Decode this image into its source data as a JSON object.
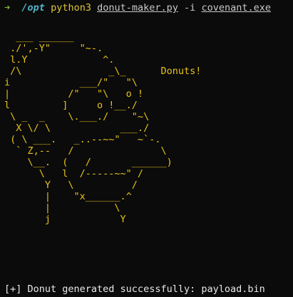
{
  "prompt": {
    "arrow": "➜",
    "cwd": "/opt",
    "command": "python3",
    "script": "donut-maker.py",
    "flag": "-i",
    "input_file": "covenant.exe"
  },
  "ascii_art": "  ___ ______\n ./',-Y\"     \"~-.\n l.Y             ^.\n /\\               _\\_      Donuts!\ni            ___/\"   \"\\\n|          /\"   \"\\   o !\nl         ]     o !__./\n \\ _  _    \\.___./    \"~\\\n  X \\/ \\            ___./\n ( \\ ___.   _..--~~\"   ~`-.\n  ` Z,--   /               \\\n    \\__.  (   /       ______)\n      \\   l  /-----~~\" /\n       Y   \\          /\n       |    \"x______.^\n       |           \\\n       j            Y",
  "status_message": "[+] Donut generated successfully: payload.bin",
  "colors": {
    "background": "#0b0b0b",
    "arrow": "#7dbb3c",
    "cwd": "#4fb6c8",
    "command": "#e0c43a",
    "art": "#e6c21a",
    "text": "#e8e8e8"
  }
}
